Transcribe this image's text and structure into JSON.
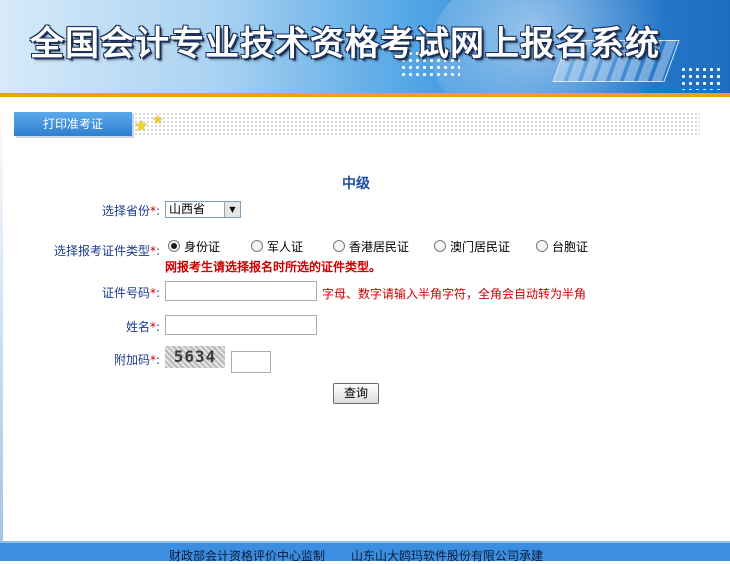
{
  "header": {
    "title": "全国会计专业技术资格考试网上报名系统"
  },
  "tabs": [
    {
      "label": "打印准考证"
    }
  ],
  "main": {
    "heading": "中级",
    "fields": {
      "province": {
        "label": "选择省份",
        "required_mark": "*",
        "colon": ":",
        "value": "山西省"
      },
      "id_type": {
        "label": "选择报考证件类型",
        "required_mark": "*",
        "colon": ":",
        "options": [
          "身份证",
          "军人证",
          "香港居民证",
          "澳门居民证",
          "台胞证"
        ],
        "selected": "身份证",
        "warning": "网报考生请选择报名时所选的证件类型。"
      },
      "id_number": {
        "label": "证件号码",
        "required_mark": "*",
        "colon": ":",
        "value": "",
        "hint": "字母、数字请输入半角字符，全角会自动转为半角"
      },
      "name": {
        "label": "姓名",
        "required_mark": "*",
        "colon": ":",
        "value": ""
      },
      "captcha": {
        "label": "附加码",
        "required_mark": "*",
        "colon": ":",
        "image_text": "5634",
        "value": ""
      }
    },
    "submit_label": "查询"
  },
  "footer": {
    "organizer": "财政部会计资格评价中心监制",
    "developer": "山东山大鸥玛软件股份有限公司承建"
  },
  "colors": {
    "banner_blue": "#2f86d6",
    "accent_gold": "#e8a317",
    "label_blue": "#1a3b8c",
    "required_red": "#d00000",
    "footer_blue": "#3c8fe0"
  }
}
